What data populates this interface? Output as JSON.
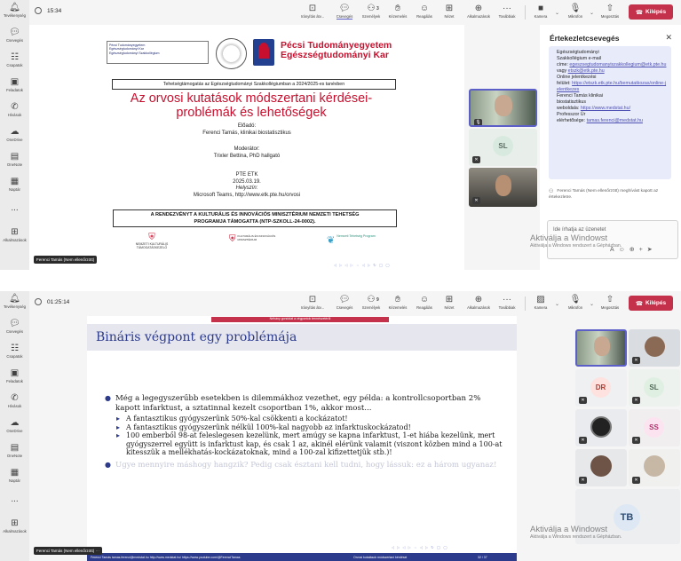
{
  "rail": [
    {
      "label": "Tevékenység",
      "icon": "bell-icon"
    },
    {
      "label": "Csevegés",
      "icon": "chat-icon"
    },
    {
      "label": "Csapatok",
      "icon": "teams-icon"
    },
    {
      "label": "Feladatok",
      "icon": "tasks-icon"
    },
    {
      "label": "Hívások",
      "icon": "phone-icon"
    },
    {
      "label": "OneDrive",
      "icon": "cloud-icon"
    },
    {
      "label": "OneNote",
      "icon": "onenote-icon"
    },
    {
      "label": "Naptár",
      "icon": "calendar-icon"
    },
    {
      "label": "...",
      "icon": "more-icon"
    },
    {
      "label": "Alkalmazások",
      "icon": "apps-icon"
    }
  ],
  "toolbar": {
    "raise_hand": "Irányítás átv...",
    "chat": "Csevegés",
    "people": "Személyek",
    "react": "Kézemelés",
    "reactions": "Reagálás",
    "view": "Nézet",
    "apps": "Alkalmazások",
    "more": "Továbbiak",
    "camera": "Kamera",
    "mic": "Mikrofon",
    "share": "Megosztás",
    "leave": "Kilépés"
  },
  "top": {
    "timer": "15:34",
    "people_count": "3"
  },
  "bottom": {
    "timer": "01:25:14",
    "people_count": "9"
  },
  "slide1": {
    "box_lines": [
      "Pécsi Tudományegyetem",
      "Egészségtudományi Kar",
      "Egészségtudományi Szakkollégium"
    ],
    "uni_line1": "Pécsi Tudományegyetem",
    "uni_line2": "Egészségtudományi Kar",
    "program": "Tehetségtámogatás az Egészségtudományi Szakkollégiumban a 2024/2025-es tanévben",
    "title1": "Az orvosi kutatások módszertani kérdései-",
    "title2": "problémák és lehetőségek",
    "presenter_label": "Előadó:",
    "presenter": "Ferenci Tamás, klinikai biostatisztikus",
    "moderator_label": "Moderátor:",
    "moderator": "Trixler Bettina, PhD hallgató",
    "venue": "PTE ETK",
    "date": "2025.03.19.",
    "place_label": "Helyszín:",
    "place": "Microsoft Teams, http://www.etk.pte.hu/orvosi",
    "support1": "A RENDEZVÉNYT A KULTURÁLIS ÉS INNOVÁCIÓS MINISZTÉRIUM NEMZETI TEHETSÉG",
    "support2": "PROGRAMJA TÁMOGATTA (NTP-SZKOLL-24-0002).",
    "logo1": "NEMZETI KULTURÁLIS TÁMOGATÁSKEZELŐ",
    "logo2": "KULTURÁLIS ÉS INNOVÁCIÓS MINISZTÉRIUM",
    "logo3": "Nemzeti Tehetség Program",
    "speaker": "Ferenci Tamás (Nem ellenőrzött)"
  },
  "slide2": {
    "banner": "Néhány gondolat a végpontok természetéről",
    "title": "Bináris végpont egy problémája",
    "bullet1": "Még a legegyszerűbb esetekben is dilemmákhoz vezethet, egy példa: a kontrollcsoportban 2% kapott infarktust, a sztatinnal kezelt csoportban 1%, akkor most...",
    "sub1": "A fantasztikus gyógyszerünk 50%-kal csökkenti a kockázatot!",
    "sub2": "A fantasztikus gyógyszerünk nélkül 100%-kal nagyobb az infarktuskockázatod!",
    "sub3": "100 emberből 98-at feleslegesen kezelünk, mert amúgy se kapna infarktust, 1-et hiába kezelünk, mert gyógyszerrel együtt is infarktust kap, és csak 1 az, akinél elérünk valamit (viszont közben mind a 100-at kitesszük a mellékhatás-kockázatoknak, mind a 100-zal kifizettetjük stb.)!",
    "bullet2": "Ugye mennyire máshogy hangzik? Pedig csak észtani kell tudni, hogy lássuk: ez a három ugyanaz!",
    "footer_left": "Ferenci Tamás tamas.ferenci@medstat.hu  http://www.medstat.hu/  https://www.youtube.com/@FerenciTamas",
    "footer_mid": "Orvosi kutatások módszertani kérdései",
    "page": "32 / 37",
    "speaker": "Ferenci Tamás (Nem ellenőrzött)"
  },
  "tiles_top": [
    {
      "initials": "",
      "kind": "video-person",
      "active": true
    },
    {
      "initials": "SL",
      "kind": "avatar",
      "color": "#d8eadf",
      "fg": "#5b6b60"
    },
    {
      "initials": "",
      "kind": "video-person2",
      "active": false
    }
  ],
  "tiles_bottom": [
    {
      "initials": "",
      "kind": "video"
    },
    {
      "initials": "",
      "kind": "photo"
    },
    {
      "initials": "DR",
      "kind": "avatar",
      "color": "#fde2df",
      "fg": "#b23a30"
    },
    {
      "initials": "SL",
      "kind": "avatar",
      "color": "#dff0e3",
      "fg": "#4f6b57"
    },
    {
      "initials": "",
      "kind": "photo2"
    },
    {
      "initials": "SS",
      "kind": "avatar",
      "color": "#fbe4ef",
      "fg": "#b1356f"
    },
    {
      "initials": "",
      "kind": "photo3"
    },
    {
      "initials": "",
      "kind": "photo4"
    },
    {
      "initials": "TB",
      "kind": "avatar",
      "color": "#dde8f4",
      "fg": "#2f4e75"
    }
  ],
  "chat": {
    "title": "Értekezletcsevegés",
    "message": {
      "l1": "Egészségtudományi",
      "l2": "Szakkollégium e-mail",
      "l3": "címe: ",
      "link1": "egeszsegtudomanyiszakkollegium@etk.pte.hu",
      "l4": "vagy ",
      "link2": "etszk@etk.pte.hu",
      "l5": "Online jelentkezési",
      "l6": "felület: ",
      "link3": "https://etszk.etk.pte.hu/bemutatkozas/online-jelentkezes",
      "l7": "Ferenci Tamás klinikai",
      "l8": "biostatisztikus",
      "l9": "weboldala: ",
      "link4": "https://www.medstat.hu/",
      "l10": "Professzor Úr",
      "l11": "elérhetősége: ",
      "link5": "tamas.ferenci@medstat.hu"
    },
    "system": "Ferenci Tamás (Nem ellenőrzött) meghívást kapott az értekezletre.",
    "compose_placeholder": "Ide írhatja az üzenetet"
  },
  "watermark": {
    "line1": "Aktiválja a Windowst",
    "line2": "Aktiválja a Windows rendszert a Gépházban."
  },
  "colors": {
    "accent": "#5b5fc7",
    "leave": "#c4314b",
    "slide_red": "#c8102e",
    "slide_blue": "#2c3b8c"
  }
}
